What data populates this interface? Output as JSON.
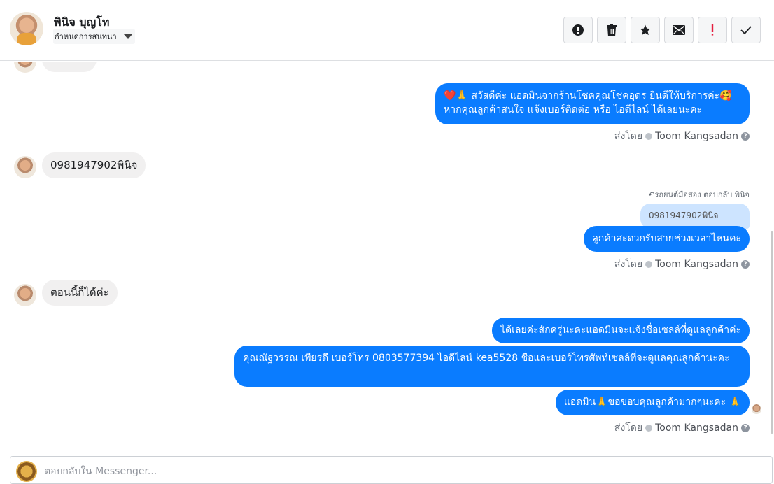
{
  "header": {
    "contact_name": "พินิจ บุญโท",
    "conversation_dropdown": "กำหนดการสนทนา",
    "actions": [
      {
        "name": "spam-button",
        "icon": "alert-circle-icon"
      },
      {
        "name": "delete-button",
        "icon": "trash-icon"
      },
      {
        "name": "star-button",
        "icon": "star-icon"
      },
      {
        "name": "mark-unread-button",
        "icon": "envelope-icon"
      },
      {
        "name": "important-button",
        "icon": "exclamation-icon"
      },
      {
        "name": "mark-done-button",
        "icon": "checkmark-icon"
      }
    ]
  },
  "messages": {
    "partial_top": "สนใจค่ะ",
    "out1_line1": "❤️🙏 สวัสดีค่ะ แอดมินจากร้านโชคคุณโชคอุดร ยินดีให้บริการค่ะ🥰",
    "out1_line2": "หากคุณลูกค้าสนใจ แจ้งเบอร์ติดต่อ หรือ ไอดีไลน์ ได้เลยนะคะ",
    "sent_by_label": "ส่งโดย",
    "sender_name": "Toom Kangsadan",
    "in1": "0981947902พินิจ",
    "reply_note": "↶รถยนต์มือสอง ตอบกลับ พินิจ",
    "quoted_text": "0981947902พินิจ",
    "out2": "ลูกค้าสะดวกรับสายช่วงเวลาไหนคะ",
    "in2": "ตอนนี้ก็ได้ค่ะ",
    "out3": "ได้เลยค่ะสักครู่นะคะแอดมินจะแจ้งชื่อเซลล์ที่ดูแลลูกค้าค่ะ",
    "out4": "คุณณัฐวรรณ เพียรดี        เบอร์โทร 0803577394  ไอดีไลน์ kea5528 ชื่อและเบอร์โทรศัพท์เซลล์ที่จะดูแลคุณลูกค้านะคะ",
    "out5": "แอดมิน🙏ขอขอบคุณลูกค้ามากๆนะคะ 🙏"
  },
  "composer": {
    "placeholder": "ตอบกลับใน Messenger..."
  },
  "colors": {
    "outgoing_bubble": "#0a7cff",
    "incoming_bubble": "#f1f0f0",
    "important_red": "#e41e3f"
  }
}
